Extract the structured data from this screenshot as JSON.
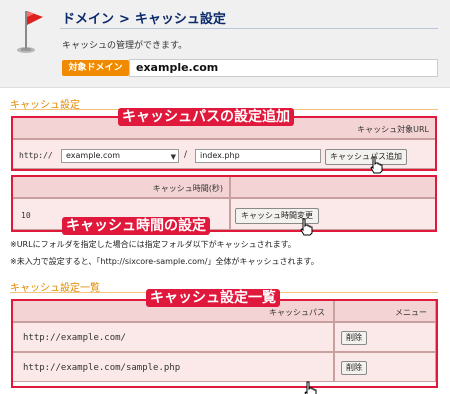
{
  "header": {
    "breadcrumb_root": "ドメイン",
    "breadcrumb_sep": ">",
    "breadcrumb_current": "キャッシュ設定",
    "description": "キャッシュの管理ができます。",
    "domain_badge": "対象ドメイン",
    "domain_value": "example.com",
    "icon": "red-flag-icon"
  },
  "cache_settings": {
    "title": "キャッシュ設定",
    "path_header": "キャッシュ対象URL",
    "http_prefix": "http://",
    "domain_select_value": "example.com",
    "slash": "/",
    "path_input_value": "index.php",
    "add_button": "キャッシュパス追加",
    "time_header": "キャッシュ時間(秒)",
    "time_value": "10",
    "change_button": "キャッシュ時間変更"
  },
  "notes": [
    "※URLにフォルダを指定した場合には指定フォルダ以下がキャッシュされます。",
    "※未入力で設定すると、「http://sixcore-sample.com/」全体がキャッシュされます。"
  ],
  "cache_list": {
    "title": "キャッシュ設定一覧",
    "col_path": "キャッシュパス",
    "col_menu": "メニュー",
    "rows": [
      {
        "path": "http://example.com/",
        "delete_label": "削除"
      },
      {
        "path": "http://example.com/sample.php",
        "delete_label": "削除"
      }
    ]
  },
  "annotations": {
    "path_callout": "キャッシュパスの設定追加",
    "time_callout": "キャッシュ時間の設定",
    "list_callout": "キャッシュ設定一覧",
    "accent_color": "#e0183c"
  }
}
